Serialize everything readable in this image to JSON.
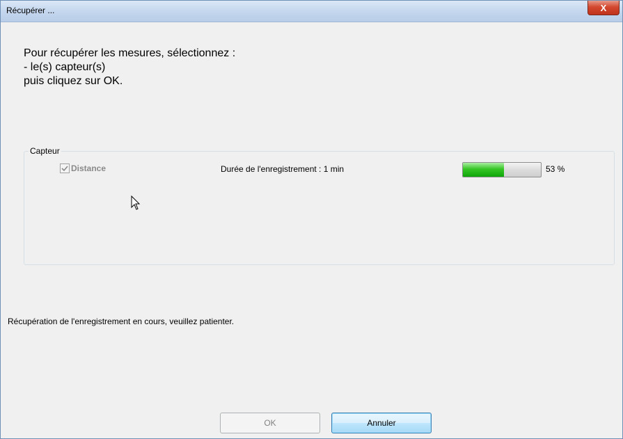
{
  "window": {
    "title": "Récupérer ...",
    "close_label": "X"
  },
  "instructions": {
    "line1": "Pour récupérer les mesures, sélectionnez :",
    "line2": "- le(s) capteur(s)",
    "line3": "puis cliquez sur OK."
  },
  "sensor_group": {
    "label": "Capteur",
    "sensor": {
      "name": "Distance",
      "checked": true,
      "duration_text": "Durée de l'enregistrement : 1 min",
      "progress_percent": 53,
      "progress_label": "53 %"
    }
  },
  "status": {
    "text": "Récupération de l'enregistrement en cours, veuillez patienter."
  },
  "buttons": {
    "ok_label": "OK",
    "cancel_label": "Annuler"
  },
  "colors": {
    "progress_fill": "#0fa60a",
    "close_button": "#c0321b",
    "default_button_border": "#3c7fb1"
  },
  "icons": {
    "close": "close-icon",
    "checkbox": "checkmark-icon",
    "cursor": "mouse-pointer-icon"
  }
}
